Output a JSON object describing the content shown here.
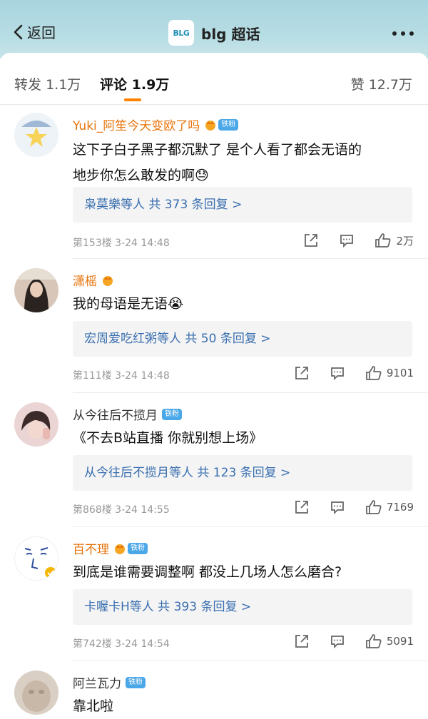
{
  "header": {
    "back_label": "返回",
    "logo_text": "BLG",
    "title": "blg 超话"
  },
  "tabs": [
    {
      "label": "转发",
      "count": "1.1万"
    },
    {
      "label": "评论",
      "count": "1.9万"
    },
    {
      "label": "赞",
      "count": "12.7万"
    }
  ],
  "fan_badge": "铁粉",
  "comments": [
    {
      "name": "Yuki_阿笙今天变欧了吗",
      "text1": "这下子白子黑子都沉默了  是个人看了都会无语的",
      "text2": "地步你怎么敢发的啊😓",
      "replies": "枭莫樂等人  共 373 条回复 >",
      "meta": "第153楼  3-24 14:48",
      "likes": "2万"
    },
    {
      "name": "潇榣",
      "text1": "我的母语是无语😭",
      "replies": "宏周爱吃红粥等人  共 50 条回复 >",
      "meta": "第111楼  3-24 14:48",
      "likes": "9101"
    },
    {
      "name": "从今往后不揽月",
      "text1": "《不去B站直播 你就别想上场》",
      "replies": "从今往后不揽月等人  共 123 条回复 >",
      "meta": "第868楼  3-24 14:55",
      "likes": "7169"
    },
    {
      "name": "百不理",
      "text1": "到底是谁需要调整啊 都没上几场人怎么磨合?",
      "replies": "卡喔卡H等人  共 393 条回复 >",
      "meta": "第742楼  3-24 14:54",
      "likes": "5091"
    },
    {
      "name": "阿兰瓦力",
      "text1": "靠北啦"
    }
  ]
}
